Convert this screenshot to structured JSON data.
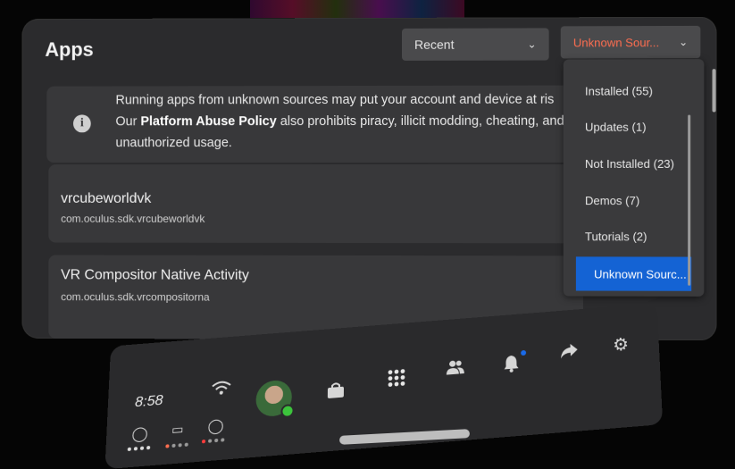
{
  "panel": {
    "title": "Apps",
    "sort": {
      "value": "Recent"
    },
    "filter": {
      "value": "Unknown Sour..."
    }
  },
  "warning": {
    "line1": "Running apps from unknown sources may put your account and device at ris",
    "line2_prefix": "Our ",
    "line2_link": "Platform Abuse Policy",
    "line2_suffix": " also prohibits piracy, illicit modding, cheating, and",
    "line3": "unauthorized usage."
  },
  "apps": [
    {
      "name": "vrcubeworldvk",
      "package": "com.oculus.sdk.vrcubeworldvk"
    },
    {
      "name": "VR Compositor Native Activity",
      "package": "com.oculus.sdk.vrcompositorna"
    }
  ],
  "filter_menu": {
    "items": [
      {
        "label": "Installed (55)"
      },
      {
        "label": "Updates (1)"
      },
      {
        "label": "Not Installed (23)"
      },
      {
        "label": "Demos (7)"
      },
      {
        "label": "Tutorials (2)"
      },
      {
        "label": "Unknown Sourc..."
      }
    ],
    "selected": "Unknown Sourc..."
  },
  "taskbar": {
    "time": "8:58",
    "icons": [
      "wifi-icon",
      "store-icon",
      "apps-grid-icon",
      "people-icon",
      "bell-icon",
      "share-icon",
      "settings-icon"
    ]
  },
  "colors": {
    "accent": "#1463d4",
    "filter_text": "#ff6e50",
    "panel_bg": "#2b2b2d",
    "status_online": "#3cc43c"
  }
}
